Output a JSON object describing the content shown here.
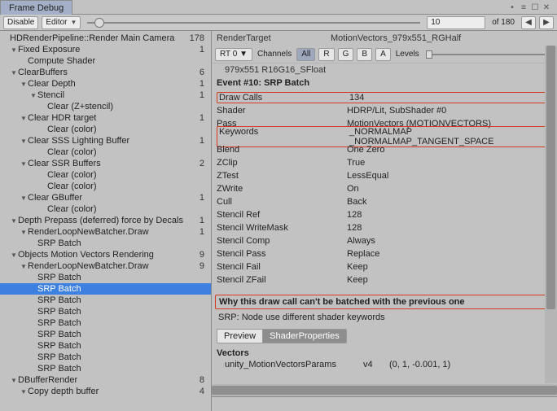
{
  "window": {
    "title": "Frame Debug"
  },
  "toolbar": {
    "enable_label": "Disable",
    "mode_label": "Editor",
    "current_frame": "10",
    "total_frames": "of 180"
  },
  "tree": [
    {
      "ind": 0,
      "disc": "",
      "label": "HDRenderPipeline::Render Main Camera",
      "count": "178"
    },
    {
      "ind": 1,
      "disc": "▼",
      "label": "Fixed Exposure",
      "count": "1"
    },
    {
      "ind": 2,
      "disc": "",
      "label": "Compute Shader",
      "count": ""
    },
    {
      "ind": 1,
      "disc": "▼",
      "label": "ClearBuffers",
      "count": "6"
    },
    {
      "ind": 2,
      "disc": "▼",
      "label": "Clear Depth",
      "count": "1"
    },
    {
      "ind": 3,
      "disc": "▼",
      "label": "Stencil",
      "count": "1"
    },
    {
      "ind": 4,
      "disc": "",
      "label": "Clear (Z+stencil)",
      "count": ""
    },
    {
      "ind": 2,
      "disc": "▼",
      "label": "Clear HDR target",
      "count": "1"
    },
    {
      "ind": 4,
      "disc": "",
      "label": "Clear (color)",
      "count": ""
    },
    {
      "ind": 2,
      "disc": "▼",
      "label": "Clear SSS Lighting Buffer",
      "count": "1"
    },
    {
      "ind": 4,
      "disc": "",
      "label": "Clear (color)",
      "count": ""
    },
    {
      "ind": 2,
      "disc": "▼",
      "label": "Clear SSR Buffers",
      "count": "2"
    },
    {
      "ind": 4,
      "disc": "",
      "label": "Clear (color)",
      "count": ""
    },
    {
      "ind": 4,
      "disc": "",
      "label": "Clear (color)",
      "count": ""
    },
    {
      "ind": 2,
      "disc": "▼",
      "label": "Clear GBuffer",
      "count": "1"
    },
    {
      "ind": 4,
      "disc": "",
      "label": "Clear (color)",
      "count": ""
    },
    {
      "ind": 1,
      "disc": "▼",
      "label": "Depth Prepass (deferred) force by Decals",
      "count": "1"
    },
    {
      "ind": 2,
      "disc": "▼",
      "label": "RenderLoopNewBatcher.Draw",
      "count": "1"
    },
    {
      "ind": 3,
      "disc": "",
      "label": "SRP Batch",
      "count": ""
    },
    {
      "ind": 1,
      "disc": "▼",
      "label": "Objects Motion Vectors Rendering",
      "count": "9"
    },
    {
      "ind": 2,
      "disc": "▼",
      "label": "RenderLoopNewBatcher.Draw",
      "count": "9"
    },
    {
      "ind": 3,
      "disc": "",
      "label": "SRP Batch",
      "count": ""
    },
    {
      "ind": 3,
      "disc": "",
      "label": "SRP Batch",
      "count": "",
      "selected": true
    },
    {
      "ind": 3,
      "disc": "",
      "label": "SRP Batch",
      "count": ""
    },
    {
      "ind": 3,
      "disc": "",
      "label": "SRP Batch",
      "count": ""
    },
    {
      "ind": 3,
      "disc": "",
      "label": "SRP Batch",
      "count": ""
    },
    {
      "ind": 3,
      "disc": "",
      "label": "SRP Batch",
      "count": ""
    },
    {
      "ind": 3,
      "disc": "",
      "label": "SRP Batch",
      "count": ""
    },
    {
      "ind": 3,
      "disc": "",
      "label": "SRP Batch",
      "count": ""
    },
    {
      "ind": 3,
      "disc": "",
      "label": "SRP Batch",
      "count": ""
    },
    {
      "ind": 1,
      "disc": "▼",
      "label": "DBufferRender",
      "count": "8"
    },
    {
      "ind": 2,
      "disc": "▼",
      "label": "Copy depth buffer",
      "count": "4"
    }
  ],
  "rt": {
    "label": "RenderTarget",
    "value": "MotionVectors_979x551_RGHalf",
    "output_label": "RT 0",
    "channels_label": "Channels",
    "channels": [
      "All",
      "R",
      "G",
      "B",
      "A"
    ],
    "levels_label": "Levels",
    "size_info": "979x551 R16G16_SFloat"
  },
  "event": {
    "header": "Event #10: SRP Batch",
    "props": [
      {
        "k": "Draw Calls",
        "v": "134",
        "hlk": true,
        "hlv": true
      },
      {
        "k": "Shader",
        "v": "HDRP/Lit, SubShader #0"
      },
      {
        "k": "Pass",
        "v": "MotionVectors (MOTIONVECTORS)"
      },
      {
        "k": "Keywords",
        "v": "_NORMALMAP _NORMALMAP_TANGENT_SPACE",
        "hlk": true,
        "hlv": true
      },
      {
        "k": "Blend",
        "v": "One Zero"
      },
      {
        "k": "ZClip",
        "v": "True"
      },
      {
        "k": "ZTest",
        "v": "LessEqual"
      },
      {
        "k": "ZWrite",
        "v": "On"
      },
      {
        "k": "Cull",
        "v": "Back"
      },
      {
        "k": "Stencil Ref",
        "v": "128"
      },
      {
        "k": "Stencil WriteMask",
        "v": "128"
      },
      {
        "k": "Stencil Comp",
        "v": "Always"
      },
      {
        "k": "Stencil Pass",
        "v": "Replace"
      },
      {
        "k": "Stencil Fail",
        "v": "Keep"
      },
      {
        "k": "Stencil ZFail",
        "v": "Keep"
      }
    ],
    "why_header": "Why this draw call can't be batched with the previous one",
    "why_text": "SRP: Node use different shader keywords",
    "tabs": {
      "preview": "Preview",
      "shaderprops": "ShaderProperties"
    },
    "vectors_label": "Vectors",
    "vector_row": {
      "name": "unity_MotionVectorsParams",
      "type": "v4",
      "value": "(0, 1, -0.001, 1)"
    }
  }
}
